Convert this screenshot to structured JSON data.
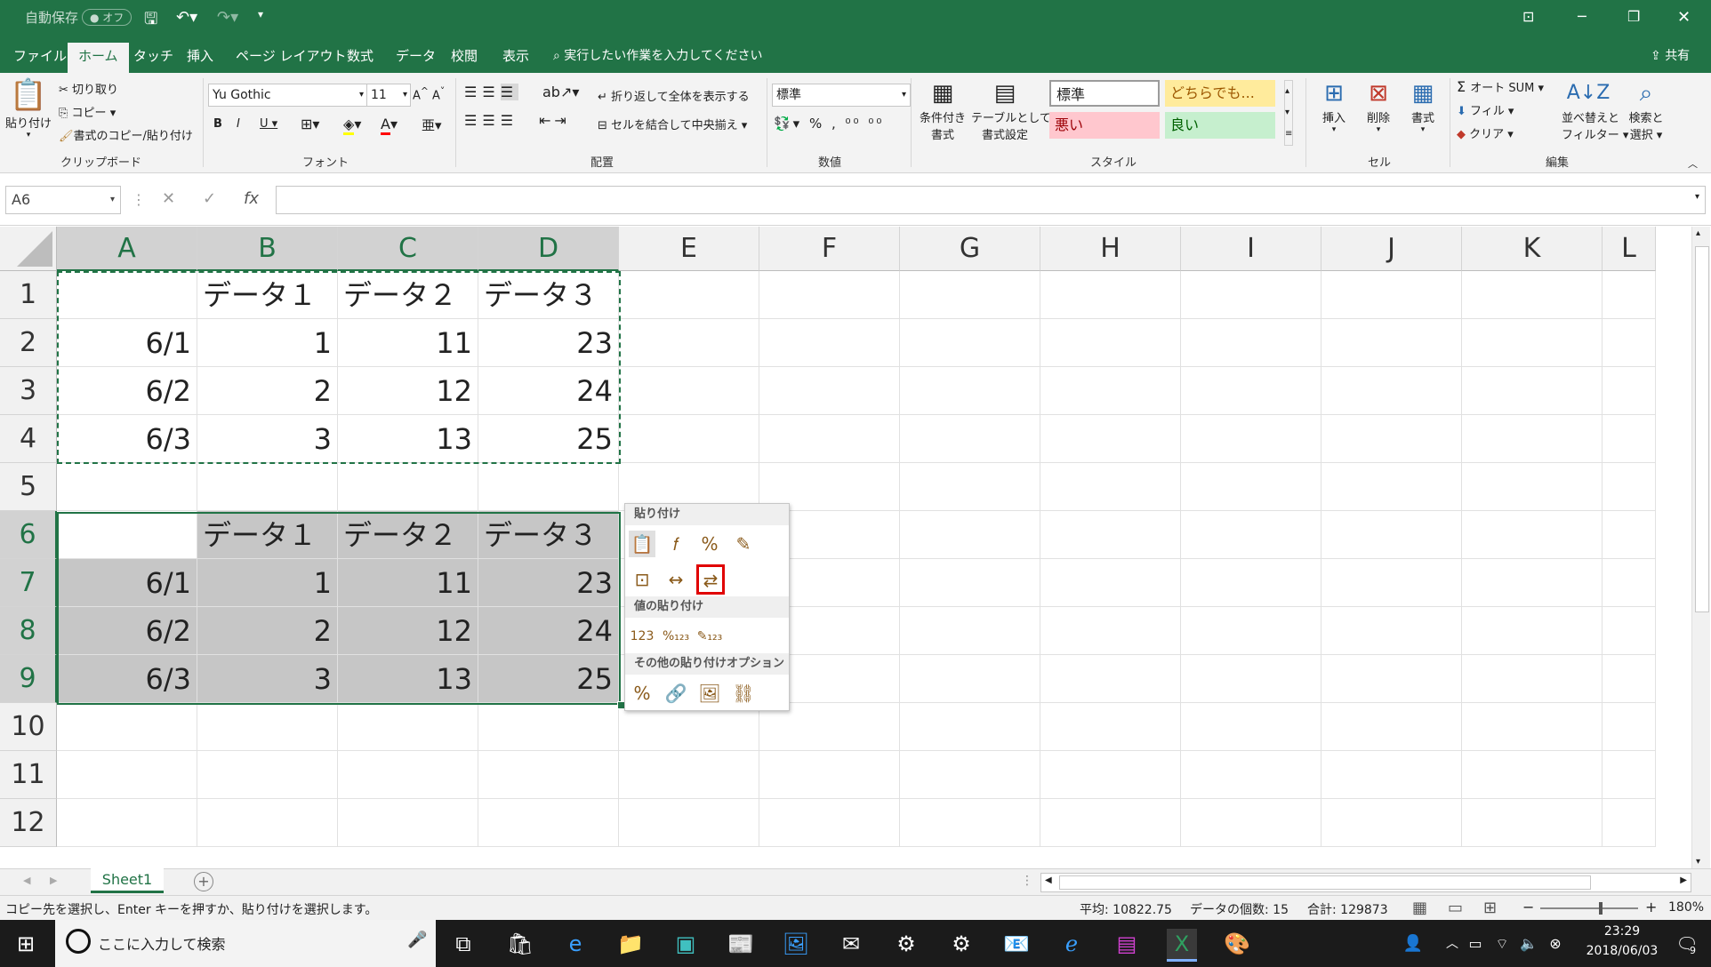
{
  "titlebar": {
    "autosave_label": "自動保存",
    "autosave_state": "オフ"
  },
  "ribbon_tabs": [
    "ファイル",
    "ホーム",
    "タッチ",
    "挿入",
    "ページ レイアウト",
    "数式",
    "データ",
    "校閲",
    "表示"
  ],
  "tell_me": "実行したい作業を入力してください",
  "share": "共有",
  "clipboard": {
    "paste": "貼り付け",
    "cut": "切り取り",
    "copy": "コピー",
    "format_painter": "書式のコピー/貼り付け",
    "group": "クリップボード"
  },
  "font": {
    "name": "Yu Gothic",
    "size": "11",
    "group": "フォント"
  },
  "alignment": {
    "wrap": "折り返して全体を表示する",
    "merge": "セルを結合して中央揃え",
    "group": "配置"
  },
  "number": {
    "format": "標準",
    "group": "数値"
  },
  "styles": {
    "conditional": [
      "条件付き",
      "書式"
    ],
    "table": [
      "テーブルとして",
      "書式設定"
    ],
    "cells": [
      {
        "label": "標準",
        "bg": "#ffffff",
        "fg": "#000000"
      },
      {
        "label": "どちらでも...",
        "bg": "#ffeb9c",
        "fg": "#9c5700"
      },
      {
        "label": "悪い",
        "bg": "#ffc7ce",
        "fg": "#9c0006"
      },
      {
        "label": "良い",
        "bg": "#c6efce",
        "fg": "#006100"
      }
    ],
    "group": "スタイル"
  },
  "cells_group": {
    "insert": "挿入",
    "delete": "削除",
    "format": "書式",
    "group": "セル"
  },
  "editing": {
    "autosum": "オート SUM",
    "fill": "フィル",
    "clear": "クリア",
    "sort": [
      "並べ替えと",
      "フィルター"
    ],
    "find": [
      "検索と",
      "選択"
    ],
    "group": "編集"
  },
  "formula_bar": {
    "name_box": "A6",
    "fx": "fx",
    "value": ""
  },
  "columns": [
    "A",
    "B",
    "C",
    "D",
    "E",
    "F",
    "G",
    "H",
    "I",
    "J",
    "K",
    "L"
  ],
  "rows": [
    [
      "",
      "データ１",
      "データ２",
      "データ３"
    ],
    [
      "6/1",
      "1",
      "11",
      "23"
    ],
    [
      "6/2",
      "2",
      "12",
      "24"
    ],
    [
      "6/3",
      "3",
      "13",
      "25"
    ],
    [
      "",
      "",
      "",
      ""
    ],
    [
      "",
      "データ１",
      "データ２",
      "データ３"
    ],
    [
      "6/1",
      "1",
      "11",
      "23"
    ],
    [
      "6/2",
      "2",
      "12",
      "24"
    ],
    [
      "6/3",
      "3",
      "13",
      "25"
    ],
    [
      "",
      "",
      "",
      ""
    ],
    [
      "",
      "",
      "",
      ""
    ],
    [
      "",
      "",
      "",
      ""
    ]
  ],
  "row_numbers": [
    "1",
    "2",
    "3",
    "4",
    "5",
    "6",
    "7",
    "8",
    "9",
    "10",
    "11",
    "12"
  ],
  "paste_menu": {
    "section1": "貼り付け",
    "section2": "値の貼り付け",
    "section3": "その他の貼り付けオプション"
  },
  "sheet_tab": "Sheet1",
  "status": {
    "message": "コピー先を選択し、Enter キーを押すか、貼り付けを選択します。",
    "average": "平均: 10822.75",
    "count": "データの個数: 15",
    "sum": "合計: 129873",
    "zoom": "180%"
  },
  "taskbar": {
    "search": "ここに入力して検索",
    "time": "23:29",
    "date": "2018/06/03",
    "notif_count": "9"
  },
  "accent": "#217346"
}
